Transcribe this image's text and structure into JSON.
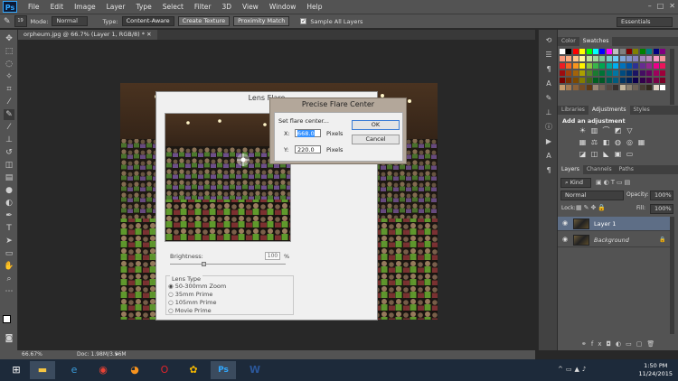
{
  "menu": {
    "logo": "Ps",
    "items": [
      "File",
      "Edit",
      "Image",
      "Layer",
      "Type",
      "Select",
      "Filter",
      "3D",
      "View",
      "Window",
      "Help"
    ]
  },
  "options": {
    "brush_size": "19",
    "mode_label": "Mode:",
    "mode_value": "Normal",
    "type_label": "Type:",
    "type_buttons": [
      "Content-Aware",
      "Create Texture",
      "Proximity Match"
    ],
    "sample_all_layers": "Sample All Layers",
    "workspace": "Essentials"
  },
  "document": {
    "tab_title": "orpheum.jpg @ 66.7% (Layer 1, RGB/8) *"
  },
  "status": {
    "zoom": "66.67%",
    "doc_size": "Doc: 1.98M/3.96M"
  },
  "lens_flare": {
    "title": "Lens Flare",
    "brightness_label": "Brightness:",
    "brightness_value": "100",
    "brightness_unit": "%",
    "brightness_fraction": 0.3,
    "lens_type_label": "Lens Type",
    "lens_types": [
      "50-300mm Zoom",
      "35mm Prime",
      "105mm Prime",
      "Movie Prime"
    ],
    "selected_lens": 0
  },
  "precise_flare": {
    "title": "Precise Flare Center",
    "prompt": "Set flare center...",
    "x_label": "X:",
    "x_value": "668.0",
    "y_label": "Y:",
    "y_value": "220.0",
    "unit": "Pixels",
    "ok_label": "OK",
    "cancel_label": "Cancel"
  },
  "panels": {
    "color_tabs": [
      "Color",
      "Swatches"
    ],
    "adj_tabs": [
      "Libraries",
      "Adjustments",
      "Styles"
    ],
    "adj_heading": "Add an adjustment",
    "layer_tabs": [
      "Layers",
      "Channels",
      "Paths"
    ],
    "kind": "Kind",
    "blend_mode": "Normal",
    "opacity_label": "Opacity:",
    "opacity_value": "100%",
    "lock_label": "Lock:",
    "fill_label": "Fill:",
    "fill_value": "100%",
    "layers": [
      "Layer 1",
      "Background"
    ],
    "swatch_colors": [
      "#ffffff",
      "#000000",
      "#ff0000",
      "#ffff00",
      "#00ff00",
      "#00ffff",
      "#0000ff",
      "#ff00ff",
      "#c0c0c0",
      "#808080",
      "#800000",
      "#808000",
      "#008000",
      "#008080",
      "#000080",
      "#800080",
      "#f7977a",
      "#fbad82",
      "#fdc68c",
      "#fff799",
      "#c6df9c",
      "#a4d49d",
      "#81ca9d",
      "#7bcdc8",
      "#6ecff6",
      "#7ea7d8",
      "#8493ca",
      "#8882be",
      "#a187be",
      "#bc8dbf",
      "#f49ac2",
      "#f6989d",
      "#ed1c24",
      "#f26522",
      "#f7941d",
      "#fff200",
      "#8dc63f",
      "#39b54a",
      "#00a651",
      "#00a99d",
      "#00aeef",
      "#0072bc",
      "#0054a6",
      "#2e3192",
      "#662d91",
      "#92278f",
      "#ec008c",
      "#ed145b",
      "#9e0b0f",
      "#a0410d",
      "#a3620a",
      "#aba000",
      "#598527",
      "#1a7b30",
      "#007236",
      "#00746b",
      "#0076a3",
      "#004b80",
      "#003471",
      "#1b1464",
      "#440e62",
      "#630460",
      "#9e005d",
      "#9e0039",
      "#790000",
      "#7b2e00",
      "#7d4900",
      "#827b00",
      "#406618",
      "#005e20",
      "#005826",
      "#005952",
      "#005b7f",
      "#003663",
      "#002157",
      "#0d004c",
      "#32004b",
      "#4b0049",
      "#7b0046",
      "#7a0026",
      "#c69c6d",
      "#a67c52",
      "#8c6239",
      "#754c24",
      "#603913",
      "#998675",
      "#736357",
      "#534741",
      "#362f2d",
      "#c2b59b",
      "#8b8170",
      "#6d6258",
      "#473c33",
      "#32291e",
      "#e0d3c5",
      "#ffffff"
    ]
  },
  "taskbar": {
    "time": "1:50 PM",
    "date": "11/24/2015"
  }
}
